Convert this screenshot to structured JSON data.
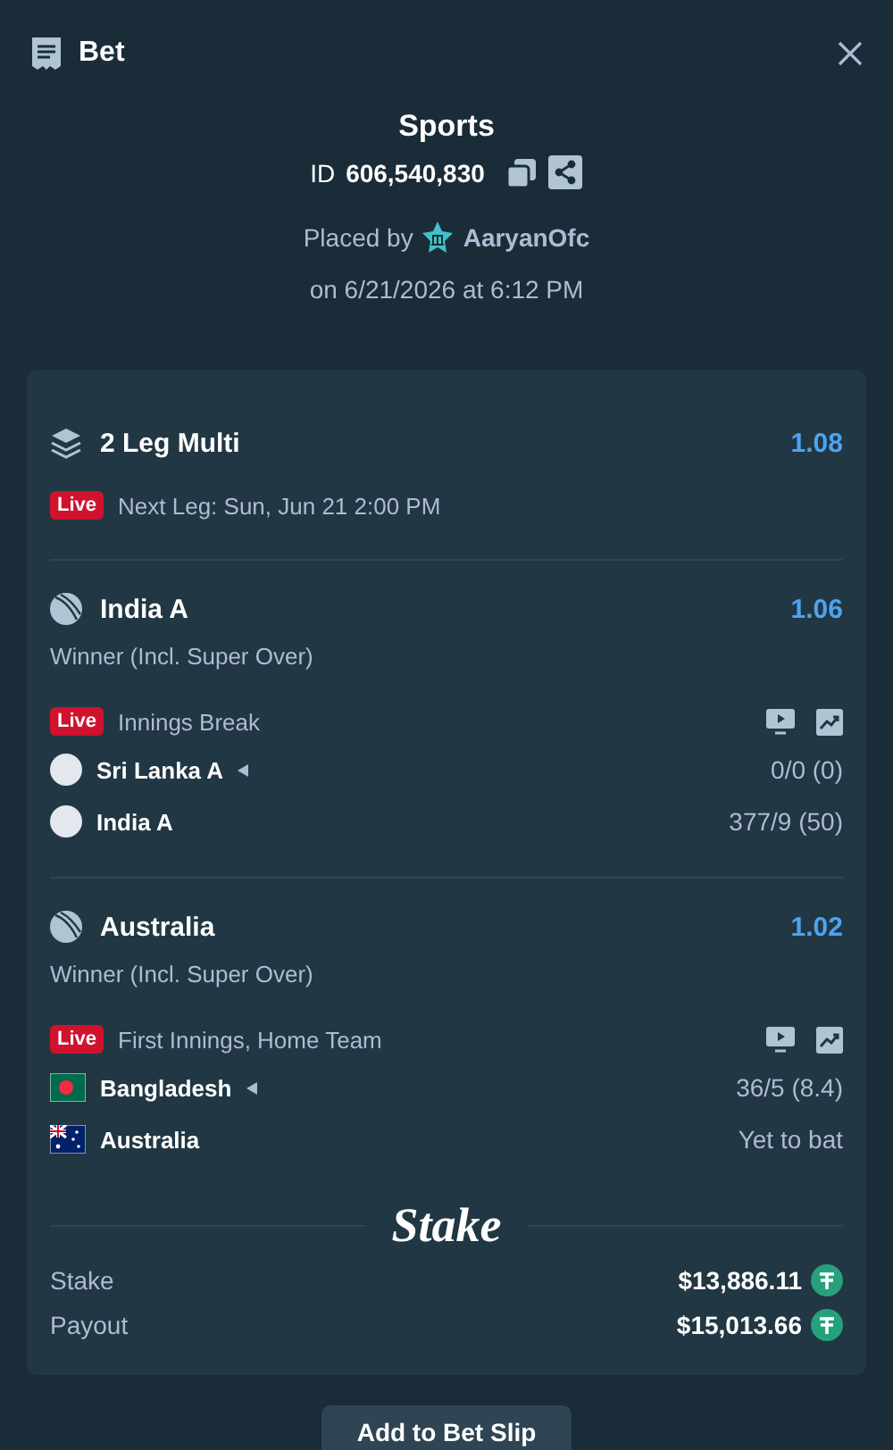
{
  "header": {
    "title": "Bet"
  },
  "summary": {
    "category": "Sports",
    "id_label": "ID",
    "id_value": "606,540,830",
    "placed_by_label": "Placed by",
    "user": "AaryanOfc",
    "placed_on": "on 6/21/2026 at 6:12 PM"
  },
  "multi": {
    "title": "2 Leg Multi",
    "odds": "1.08",
    "live_badge": "Live",
    "next_leg": "Next Leg: Sun, Jun 21 2:00 PM"
  },
  "legs": [
    {
      "selection": "India A",
      "odds": "1.06",
      "market": "Winner (Incl. Super Over)",
      "live_badge": "Live",
      "status": "Innings Break",
      "teams": [
        {
          "name": "Sri Lanka A",
          "kind": "plain",
          "batting": true,
          "score": "0/0 (0)"
        },
        {
          "name": "India A",
          "kind": "plain",
          "batting": false,
          "score": "377/9 (50)"
        }
      ]
    },
    {
      "selection": "Australia",
      "odds": "1.02",
      "market": "Winner (Incl. Super Over)",
      "live_badge": "Live",
      "status": "First Innings, Home Team",
      "teams": [
        {
          "name": "Bangladesh",
          "kind": "bangladesh",
          "batting": true,
          "score": "36/5 (8.4)"
        },
        {
          "name": "Australia",
          "kind": "australia",
          "batting": false,
          "score": "Yet to bat"
        }
      ]
    }
  ],
  "brand": "Stake",
  "totals": [
    {
      "label": "Stake",
      "amount": "$13,886.11"
    },
    {
      "label": "Payout",
      "amount": "$15,013.66"
    }
  ],
  "button": "Add to Bet Slip"
}
